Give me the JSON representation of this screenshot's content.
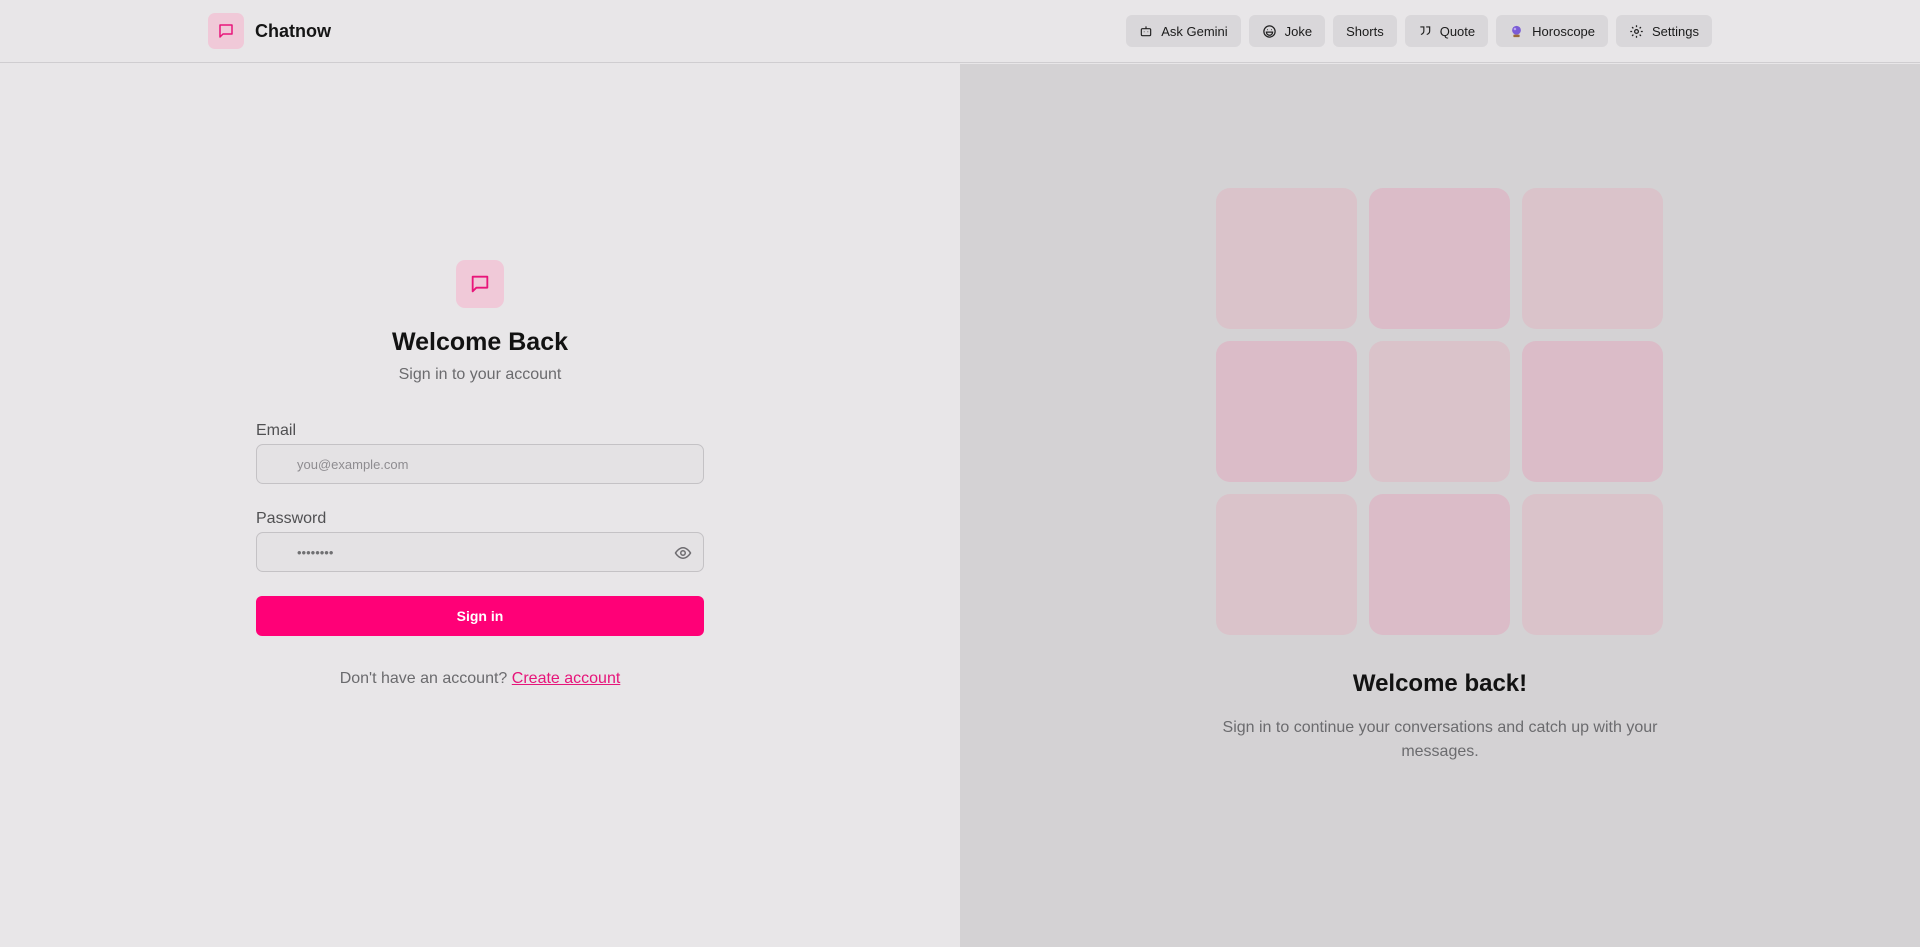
{
  "app": {
    "name": "Chatnow"
  },
  "nav": [
    {
      "label": "Ask Gemini",
      "icon": "robot-icon"
    },
    {
      "label": "Joke",
      "icon": "laugh-icon"
    },
    {
      "label": "Shorts",
      "icon": ""
    },
    {
      "label": "Quote",
      "icon": "quote-icon"
    },
    {
      "label": "Horoscope",
      "icon": "crystal-ball-icon"
    },
    {
      "label": "Settings",
      "icon": "gear-icon"
    }
  ],
  "form": {
    "title": "Welcome Back",
    "subtitle": "Sign in to your account",
    "email_label": "Email",
    "email_placeholder": "you@example.com",
    "password_label": "Password",
    "password_value": "••••••••",
    "signin_label": "Sign in",
    "signup_prompt": "Don't have an account?",
    "signup_link": "Create account"
  },
  "panel": {
    "title": "Welcome back!",
    "text": "Sign in to continue your conversations and catch up with your messages."
  },
  "colors": {
    "accent": "#ff0077",
    "logo_bg": "#f0c9d8",
    "tile_light": "#dac3ca",
    "tile_pink": "#dbbcc8"
  }
}
